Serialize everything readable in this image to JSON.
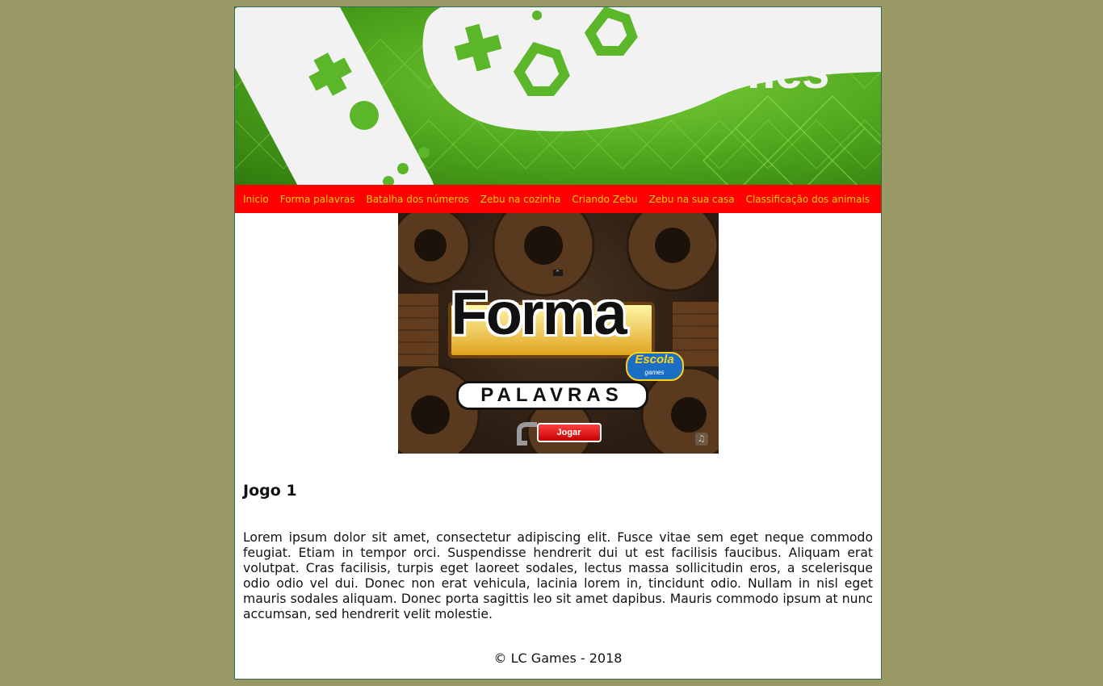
{
  "banner": {
    "title": "games",
    "colors": {
      "green_light": "#7dd13a",
      "green_dark": "#2f7a0e",
      "controller": "#f2f2f2"
    }
  },
  "nav": {
    "items": [
      {
        "label": "Inicio"
      },
      {
        "label": "Forma palavras"
      },
      {
        "label": "Batalha dos números"
      },
      {
        "label": "Zebu na cozinha"
      },
      {
        "label": "Criando Zebu"
      },
      {
        "label": "Zebu na sua casa"
      },
      {
        "label": "Classificação dos animais"
      }
    ],
    "colors": {
      "background": "#ff0000",
      "text": "#f2d200"
    }
  },
  "game_screenshot": {
    "logo_word": "Forma",
    "subtitle": "PALAVRAS",
    "badge_title": "Escola",
    "badge_sub": "games",
    "play_button": "Jogar",
    "icons": [
      "music-note-icon",
      "collapse-arrow-icon"
    ]
  },
  "article": {
    "heading": "Jogo 1",
    "body": "Lorem ipsum dolor sit amet, consectetur adipiscing elit. Fusce vitae sem eget neque commodo feugiat. Etiam in tempor orci. Suspendisse hendrerit dui ut est facilisis faucibus. Aliquam erat volutpat. Cras facilisis, turpis eget laoreet sodales, lectus massa sollicitudin eros, a scelerisque odio odio vel dui. Donec non erat vehicula, lacinia lorem in, tincidunt odio. Nullam in nisl eget mauris sodales aliquam. Donec porta sagittis leo sit amet dapibus. Mauris commodo ipsum at nunc accumsan, sed hendrerit velit molestie."
  },
  "footer": {
    "text": "© LC Games - 2018"
  },
  "colors": {
    "page_background": "#999966",
    "content_background": "#ffffff",
    "border": "#2d6b55"
  }
}
